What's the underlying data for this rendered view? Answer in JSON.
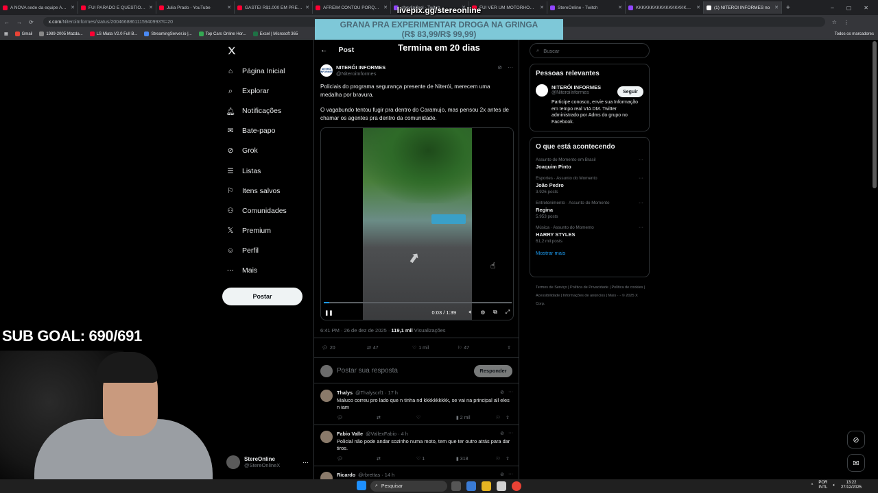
{
  "browser": {
    "tabs": [
      {
        "label": "A NOVA sede da equipe Aero",
        "color": "#ff0033"
      },
      {
        "label": "FUI PARADO E QUESTIONADO",
        "color": "#ff0033"
      },
      {
        "label": "Julia Prado - YouTube",
        "color": "#ff0033"
      },
      {
        "label": "GASTEI R$1.000 EM PRESENTE",
        "color": "#ff0033"
      },
      {
        "label": "AFREIM CONTOU PORQUE F",
        "color": "#ff0033"
      },
      {
        "label": "shevlin/feel - Twitch",
        "color": "#9146ff"
      },
      {
        "label": "FUI VER UM MOTORHOME D",
        "color": "#ff0033"
      },
      {
        "label": "StereOnline - Twitch",
        "color": "#9146ff"
      },
      {
        "label": "KKKKKKKKKKKKKKKKKKKKK",
        "color": "#9146ff"
      },
      {
        "label": "(1) NITERÓI INFORMES no",
        "color": "#ffffff"
      }
    ],
    "url_domain": "x.com",
    "url_path": "/NiteroiInformes/status/2004668861115940993?t=20",
    "bookmarks": [
      {
        "label": "Gmail",
        "color": "#ea4335"
      },
      {
        "label": "1989-2005 Mazda...",
        "color": "#888888"
      },
      {
        "label": "LS Miata V2.0 Full B...",
        "color": "#ff0033"
      },
      {
        "label": "StreamingServer.io |...",
        "color": "#4a8af4"
      },
      {
        "label": "Top Cars Online Hor...",
        "color": "#34a853"
      },
      {
        "label": "Excel | Microsoft 365",
        "color": "#1e7145"
      }
    ],
    "all_bookmarks": "Todos os marcadores"
  },
  "stream_overlay": {
    "url": "livepix.gg/stereonline",
    "promo_line1": "GRANA PRA EXPERIMENTAR DROGA NA GRINGA",
    "promo_line2": "(R$ 83,99/R$ 99,99)",
    "promo_end": "Termina em 20 dias",
    "sub_goal": "SUB GOAL: 690/691"
  },
  "nav": {
    "items": [
      {
        "label": "Página Inicial",
        "icon": "home-icon"
      },
      {
        "label": "Explorar",
        "icon": "search-icon"
      },
      {
        "label": "Notificações",
        "icon": "bell-icon"
      },
      {
        "label": "Bate-papo",
        "icon": "mail-icon"
      },
      {
        "label": "Grok",
        "icon": "grok-icon"
      },
      {
        "label": "Listas",
        "icon": "list-icon"
      },
      {
        "label": "Itens salvos",
        "icon": "bookmark-icon"
      },
      {
        "label": "Comunidades",
        "icon": "people-icon"
      },
      {
        "label": "Premium",
        "icon": "x-icon"
      },
      {
        "label": "Perfil",
        "icon": "person-icon"
      },
      {
        "label": "Mais",
        "icon": "more-circle-icon"
      }
    ],
    "post_button": "Postar",
    "account_name": "StereOnline",
    "account_handle": "@StereOnlineX"
  },
  "post": {
    "header": "Post",
    "author_name": "NITERÓI INFORMES",
    "author_handle": "@NiteroiInformes",
    "text_p1": "Policiais do programa segurança presente de Niterói, merecem uma medalha por bravura.",
    "text_p2": "O vagabundo tentou fugir pra dentro do Caramujo, mas pensou 2x antes de chamar os agentes pra dentro da comunidade.",
    "video_time": "0:03 / 1:39",
    "video_progress": 0.03,
    "timestamp": "6:41 PM · 26 de dez de 2025 ·",
    "views": "119,1 mil",
    "views_label": "Visualizações",
    "replies": "20",
    "reposts": "47",
    "likes": "1 mil",
    "bookmarks": "47",
    "reply_placeholder": "Postar sua resposta",
    "reply_button": "Responder"
  },
  "replies": [
    {
      "name": "Thalys",
      "handle": "@Thalyscrf1 · 17 h",
      "text": "Maluco correu pro lado que n tinha nd kkkkkkkkkk, se vai na principal all eles n iam",
      "views": "2 mil"
    },
    {
      "name": "Fabio Valle",
      "handle": "@VallexFabio · 4 h",
      "text": "Policial não pode andar sozinho numa moto, tem que ter outro atrás para dar tiros.",
      "likes": "1",
      "views": "318"
    },
    {
      "name": "Ricardo",
      "handle": "@rbrettas · 14 h",
      "text": ""
    }
  ],
  "sidebar": {
    "search_placeholder": "Buscar",
    "relevant_title": "Pessoas relevantes",
    "relevant_name": "NITERÓI INFORMES",
    "relevant_handle": "@NiteroiInformes",
    "relevant_bio": "Participe conosco, envie sua Informação em tempo real VIA DM. Twitter administrado por Adms do grupo no Facebook.",
    "follow_button": "Seguir",
    "trending_title": "O que está acontecendo",
    "trends": [
      {
        "category": "Assunto do Momento em Brasil",
        "name": "Joaquim Pinto",
        "posts": ""
      },
      {
        "category": "Esportes · Assunto do Momento",
        "name": "João Pedro",
        "posts": "3.926 posts"
      },
      {
        "category": "Entretenimento · Assunto do Momento",
        "name": "Regina",
        "posts": "5.953 posts"
      },
      {
        "category": "Música · Assunto do Momento",
        "name": "HARRY STYLES",
        "posts": "61,2 mil posts"
      }
    ],
    "show_more": "Mostrar mais",
    "footer": "Termos de Serviço  |  Política de Privacidade  |  Política de cookies  |  Acessibilidade  |  Informações de anúncios  |  Mais ···  © 2025 X Corp."
  },
  "taskbar": {
    "search": "Pesquisar",
    "lang1": "POR",
    "lang2": "INTL",
    "time": "13:22",
    "date": "27/12/2025"
  }
}
